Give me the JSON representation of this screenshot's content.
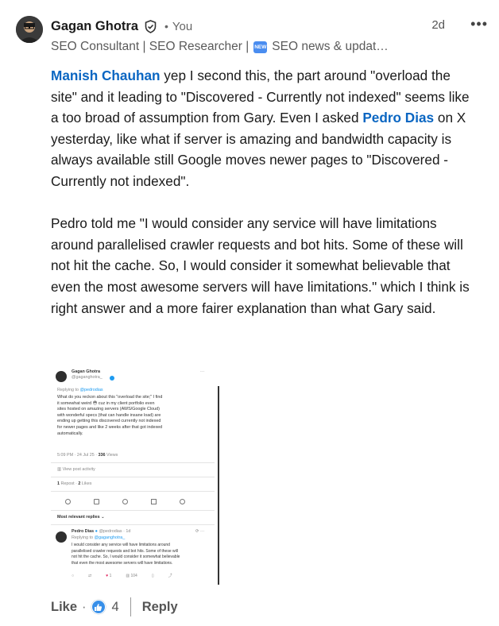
{
  "author": {
    "name": "Gagan Ghotra",
    "relation": "You",
    "time": "2d",
    "more": "•••",
    "headline_before": "SEO Consultant | SEO Researcher |",
    "headline_badge": "NEW",
    "headline_after": "SEO news & updat…"
  },
  "comment": {
    "mention1": "Manish Chauhan",
    "text1": " yep I second this, the part around \"overload the site\" and it leading to \"Discovered - Currently not indexed\" seems like a too broad of assumption from Gary. Even I asked ",
    "mention2": "Pedro Dias",
    "text2": " on X yesterday, like what if server is amazing and bandwidth capacity is always available still Google moves newer pages to \"Discovered - Currently not indexed\".",
    "paragraph2": "Pedro told me \"I would consider any service will have limitations around parallelised crawler requests and bot hits. Some of these will not hit the cache. So, I would consider it somewhat believable that even the most awesome servers will have limitations.\" which I think is right answer and a more fairer explanation than what Gary said."
  },
  "embed": {
    "tweet": {
      "name": "Gagan Ghotra",
      "handle": "@gaganghotra_",
      "replying_label": "Replying to",
      "replying_to": "@pedrodias",
      "lines": [
        "What do you reckon about this \"overload the site;\" I find",
        "it somewhat weird 😳 cuz in my client portfolio even",
        "sites hosted on amazing servers (AWS/Google Cloud)",
        "with wonderful specs (that can handle insane load) are",
        "ending up getting this discovered currently not indexed",
        "for newer pages and like 2 weeks after that got indexed",
        "automatically."
      ],
      "meta": "5:09 PM · 24 Jul 25 · ",
      "views_count": "336",
      "views_label": " Views",
      "activity": "View post activity",
      "reposts_count": "1",
      "reposts_label": " Repost · ",
      "likes_count": "2",
      "likes_label": " Likes"
    },
    "relevant": "Most relevant replies",
    "reply": {
      "name": "Pedro Dias",
      "handle": "@pedrodias · 1d",
      "replying_label": "Replying to",
      "replying_to": "@gaganghotra_",
      "lines": [
        "I would consider any service will have limitations around",
        "parallelised crawler requests and bot hits. Some of these will",
        "not hit the cache. So, I would consider it somewhat believable",
        "that even the most awesome servers will have limitations."
      ],
      "likes": "1",
      "views": "104"
    }
  },
  "footer": {
    "like_label": "Like",
    "dot": "·",
    "reaction_count": "4",
    "reply_label": "Reply"
  },
  "colors": {
    "mention": "#0a66c2",
    "like_icon": "#378fe9",
    "text": "#1a1a1a",
    "muted": "#5a5a5a"
  }
}
